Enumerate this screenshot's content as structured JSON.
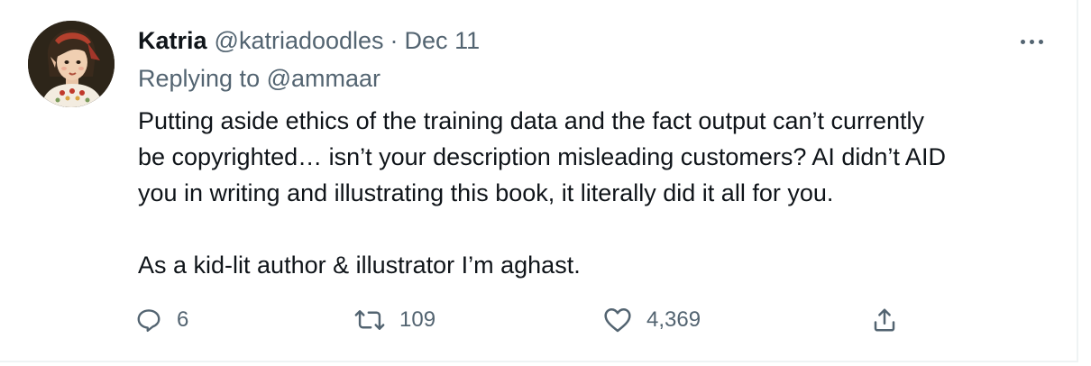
{
  "tweet": {
    "author": {
      "display_name": "Katria",
      "handle": "@katriadoodles",
      "separator": "·",
      "date": "Dec 11"
    },
    "reply_to": {
      "prefix": "Replying to",
      "handle": "@ammaar"
    },
    "body": {
      "paragraph_1": "Putting aside ethics of the training data and the fact output can’t currently\nbe copyrighted… isn’t your description misleading customers? AI didn’t AID\nyou in writing and illustrating this book, it literally did it all for you.",
      "paragraph_2": "As a kid-lit author & illustrator I’m aghast."
    },
    "actions": {
      "reply": {
        "icon": "reply-icon",
        "count": "6"
      },
      "retweet": {
        "icon": "retweet-icon",
        "count": "109"
      },
      "like": {
        "icon": "heart-icon",
        "count": "4,369"
      },
      "share": {
        "icon": "share-icon"
      }
    },
    "more_icon": "more-icon"
  },
  "colors": {
    "primary_text": "#0f1419",
    "secondary_text": "#536471",
    "border": "#eff3f4",
    "background": "#ffffff"
  }
}
